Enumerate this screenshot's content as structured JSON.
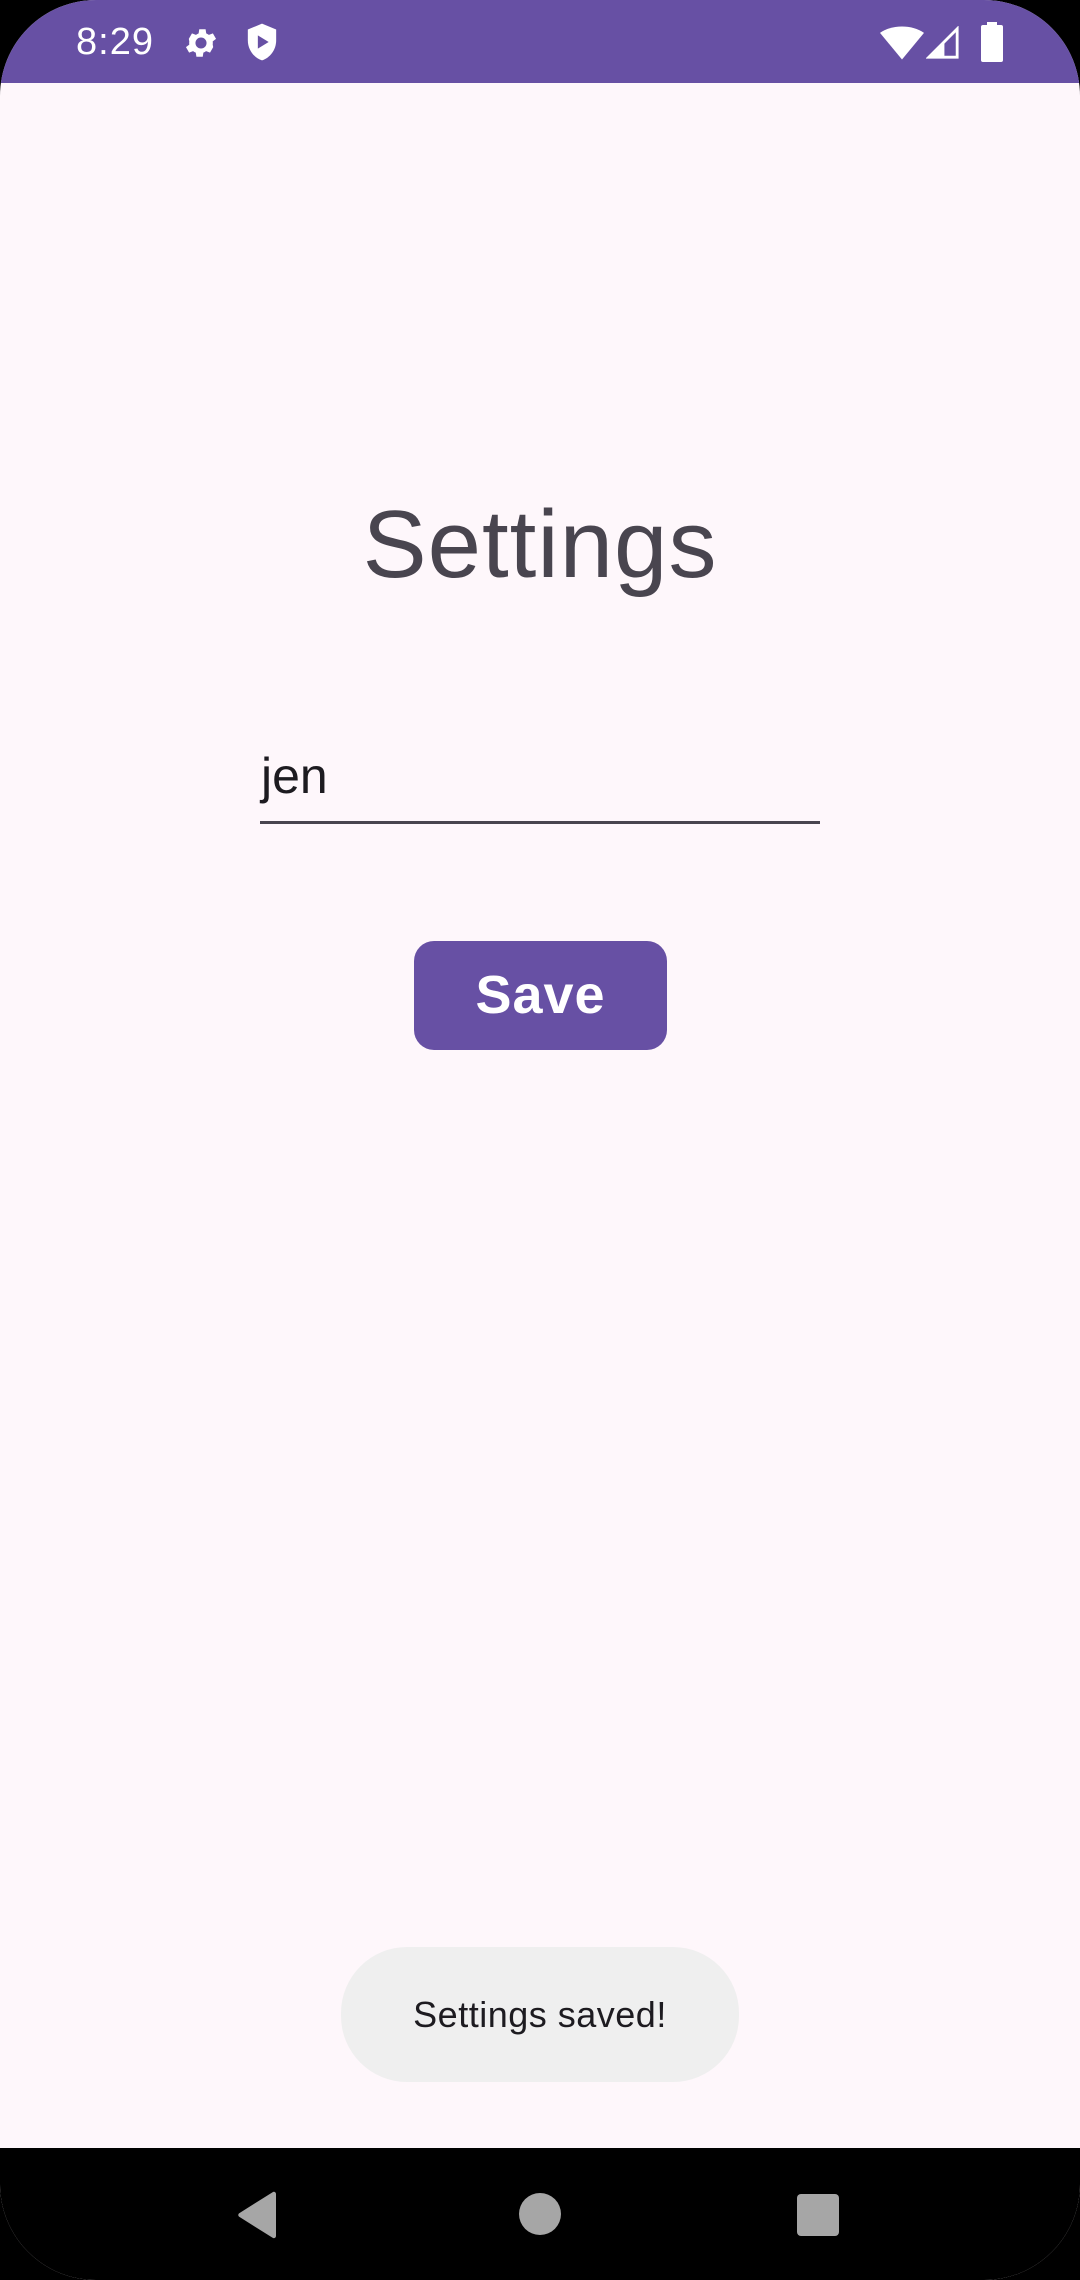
{
  "status_bar": {
    "time": "8:29",
    "icons": [
      "gear-icon",
      "shield-play-icon",
      "wifi-icon",
      "cell-signal-icon",
      "battery-icon"
    ],
    "background_color": "#6750a4"
  },
  "screen": {
    "title": "Settings",
    "name_field": {
      "value": "jen"
    },
    "save_button": {
      "label": "Save"
    },
    "toast": {
      "message": "Settings saved!"
    }
  },
  "nav_bar": {
    "buttons": [
      "back-icon",
      "home-icon",
      "recents-icon"
    ]
  },
  "colors": {
    "accent": "#6750a4",
    "background": "#fef7fb",
    "title_text": "#49454f",
    "toast_background": "#efefef"
  }
}
